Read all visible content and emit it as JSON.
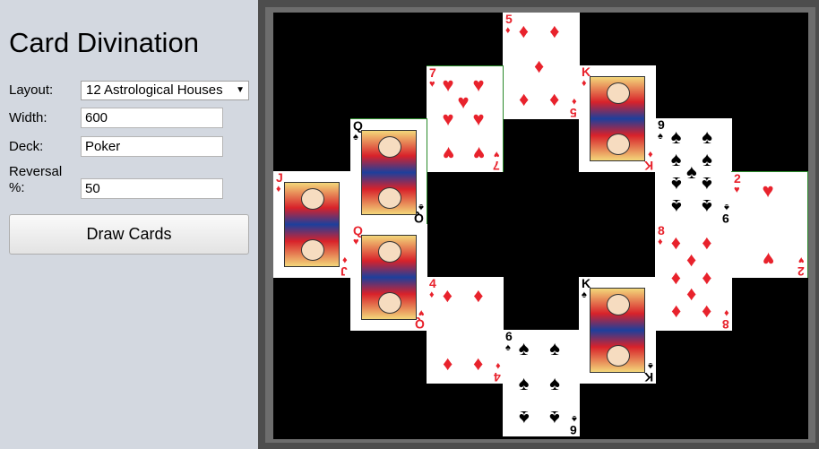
{
  "sidebar": {
    "title": "Card Divination",
    "layout_label": "Layout:",
    "layout_value": "12 Astrological Houses",
    "width_label": "Width:",
    "width_value": "600",
    "deck_label": "Deck:",
    "deck_value": "Poker",
    "reversal_label_1": "Reversal",
    "reversal_label_2": "%:",
    "reversal_value": "50",
    "draw_button": "Draw Cards"
  },
  "cards": {
    "c5d": {
      "rank": "5",
      "suit": "♦",
      "color": "#e8222c"
    },
    "c7h": {
      "rank": "7",
      "suit": "♥",
      "color": "#e8222c"
    },
    "ckd": {
      "rank": "K",
      "suit": "♦",
      "color": "#e8222c"
    },
    "c9s": {
      "rank": "9",
      "suit": "♠",
      "color": "#000000"
    },
    "cqs": {
      "rank": "Q",
      "suit": "♠",
      "color": "#000000"
    },
    "cjd": {
      "rank": "J",
      "suit": "♦",
      "color": "#e8222c"
    },
    "c2h": {
      "rank": "2",
      "suit": "♥",
      "color": "#e8222c"
    },
    "cqh": {
      "rank": "Q",
      "suit": "♥",
      "color": "#e8222c"
    },
    "c8d": {
      "rank": "8",
      "suit": "♦",
      "color": "#e8222c"
    },
    "c4d": {
      "rank": "4",
      "suit": "♦",
      "color": "#e8222c"
    },
    "cks": {
      "rank": "K",
      "suit": "♠",
      "color": "#000000"
    },
    "c6s": {
      "rank": "6",
      "suit": "♠",
      "color": "#000000"
    }
  },
  "colors": {
    "board": "#000000",
    "red_suit": "#e8222c",
    "black_suit": "#000000"
  }
}
